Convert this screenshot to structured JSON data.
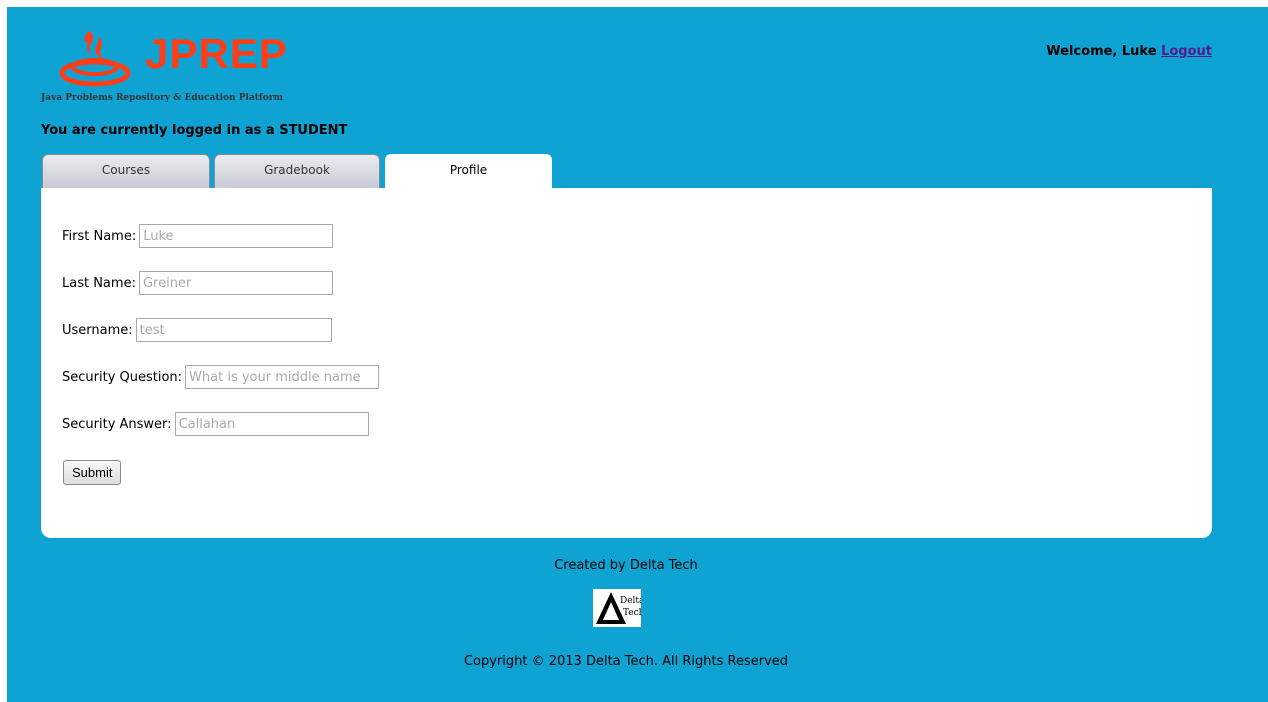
{
  "header": {
    "logo_text": "JPREP",
    "logo_tagline": "Java Problems Repository & Education Platform",
    "welcome_text": "Welcome, Luke ",
    "logout_label": "Logout",
    "role_text": "You are currently logged in as a STUDENT"
  },
  "tabs": [
    {
      "label": "Courses",
      "active": false
    },
    {
      "label": "Gradebook",
      "active": false
    },
    {
      "label": "Profile",
      "active": true
    }
  ],
  "profile_form": {
    "first_name": {
      "label": "First Name:",
      "placeholder": "Luke"
    },
    "last_name": {
      "label": "Last Name:",
      "placeholder": "Greiner"
    },
    "username": {
      "label": "Username:",
      "placeholder": "test"
    },
    "security_question": {
      "label": "Security Question:",
      "placeholder": "What is your middle name"
    },
    "security_answer": {
      "label": "Security Answer:",
      "placeholder": "Callahan"
    },
    "submit_label": "Submit"
  },
  "footer": {
    "credit": "Created by Delta Tech",
    "logo_line1": "Delta",
    "logo_line2": "Tech",
    "copyright": "Copyright © 2013 Delta Tech. All Rights Reserved"
  },
  "colors": {
    "background": "#0fa3d4",
    "logo": "#ff3d17",
    "panel": "#ffffff",
    "link": "#551a8b"
  },
  "icons": {
    "logo_mark": "flame-bowl-logo-icon",
    "footer_logo": "delta-triangle-logo-icon"
  }
}
